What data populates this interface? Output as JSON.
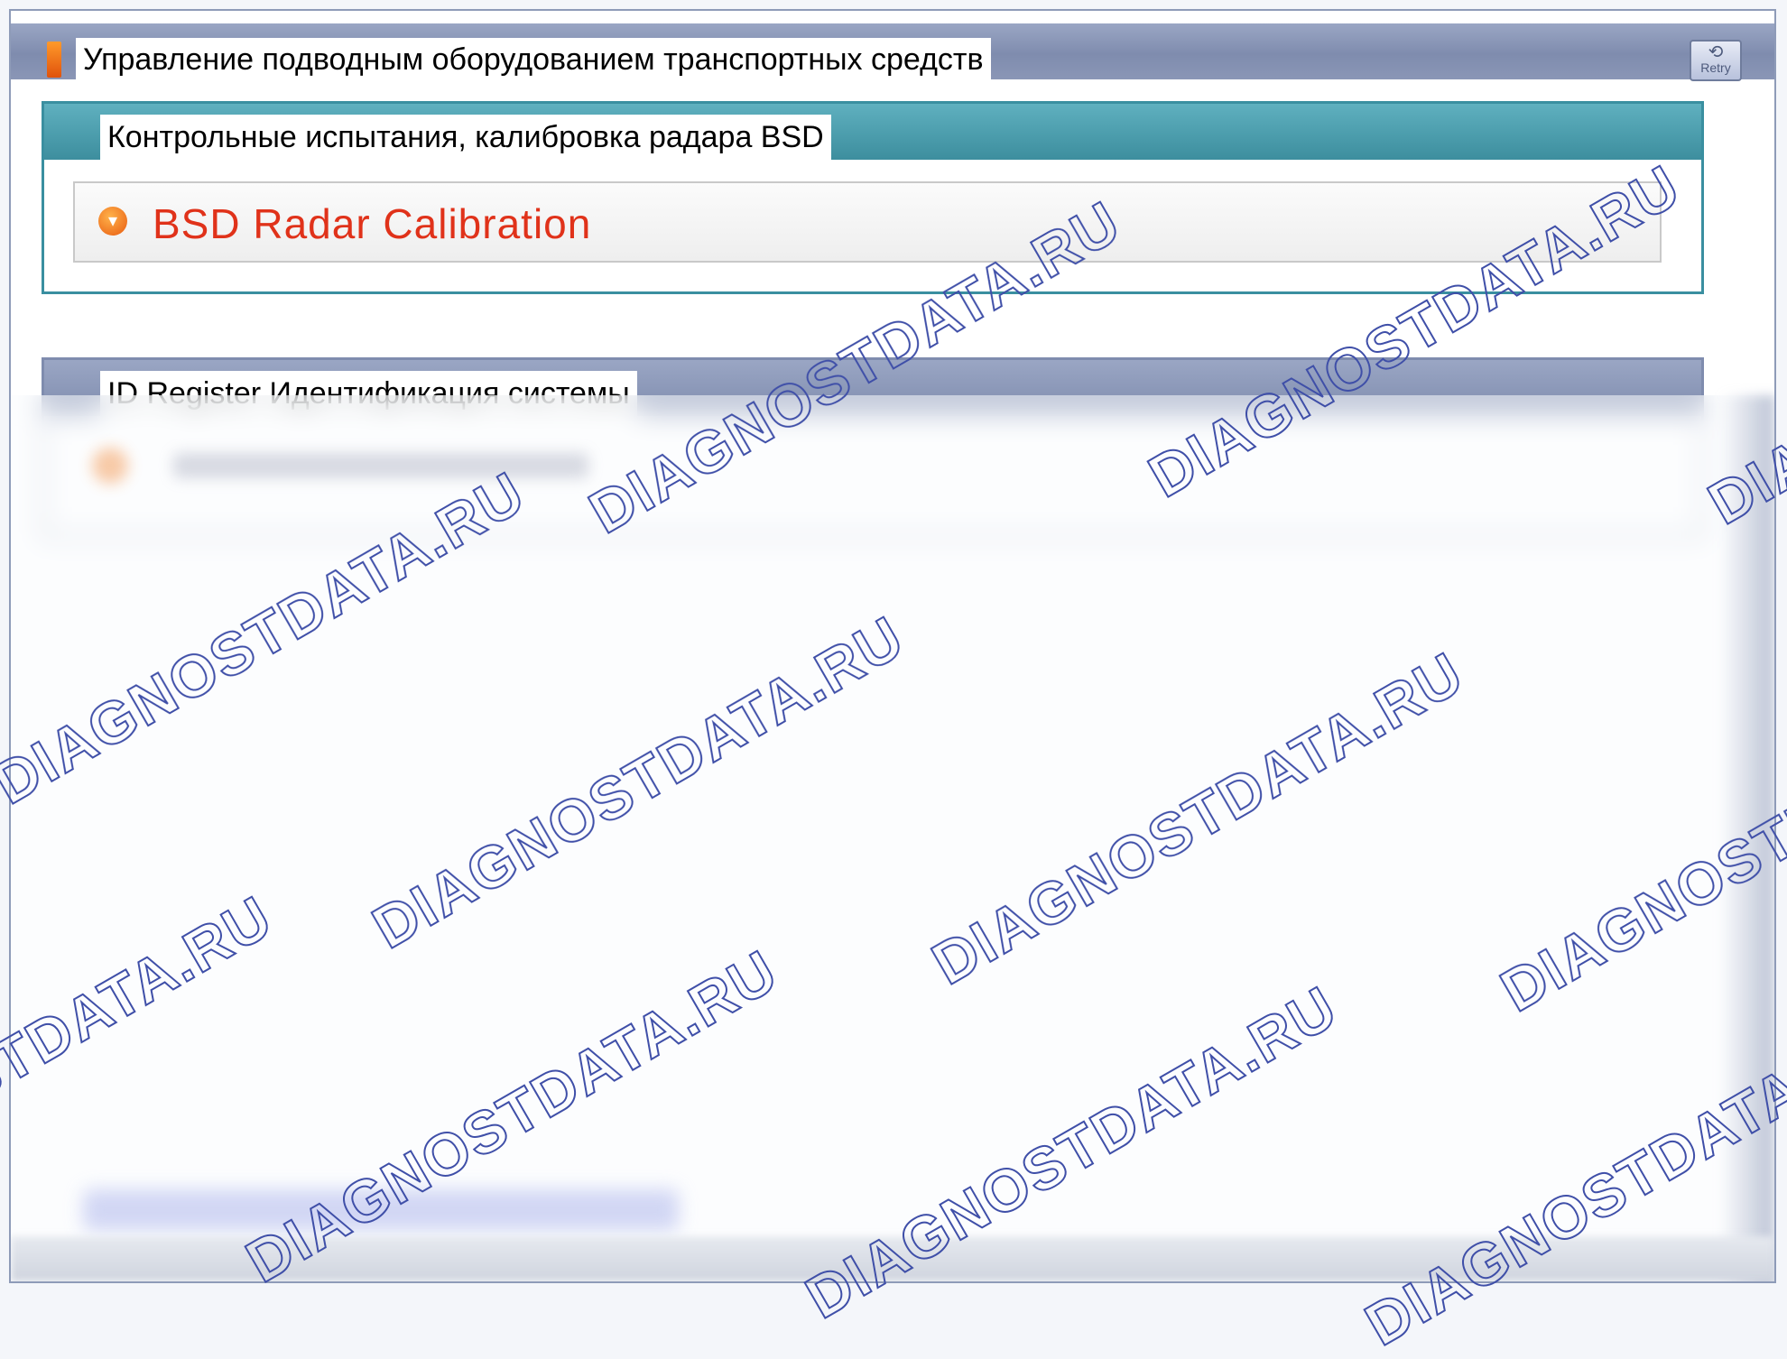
{
  "window": {
    "title": "Управление подводным оборудованием транспортных средств",
    "retry_label": "Retry"
  },
  "groups": [
    {
      "title": "Контрольные испытания, калибровка радара BSD",
      "items": [
        {
          "label": "BSD Radar Calibration"
        }
      ]
    },
    {
      "title": "ID Register Идентификация системы"
    }
  ],
  "watermark": {
    "text": "DIAGNOSTDATA.RU",
    "color": "#3f4fa8"
  },
  "colors": {
    "titlebar": "#8a96b6",
    "group_header": "#3d8e9e",
    "item_text": "#e0321a"
  },
  "icons": {
    "title": "orange-bar-icon",
    "retry": "retry-icon",
    "item": "warning-arrow-icon"
  }
}
